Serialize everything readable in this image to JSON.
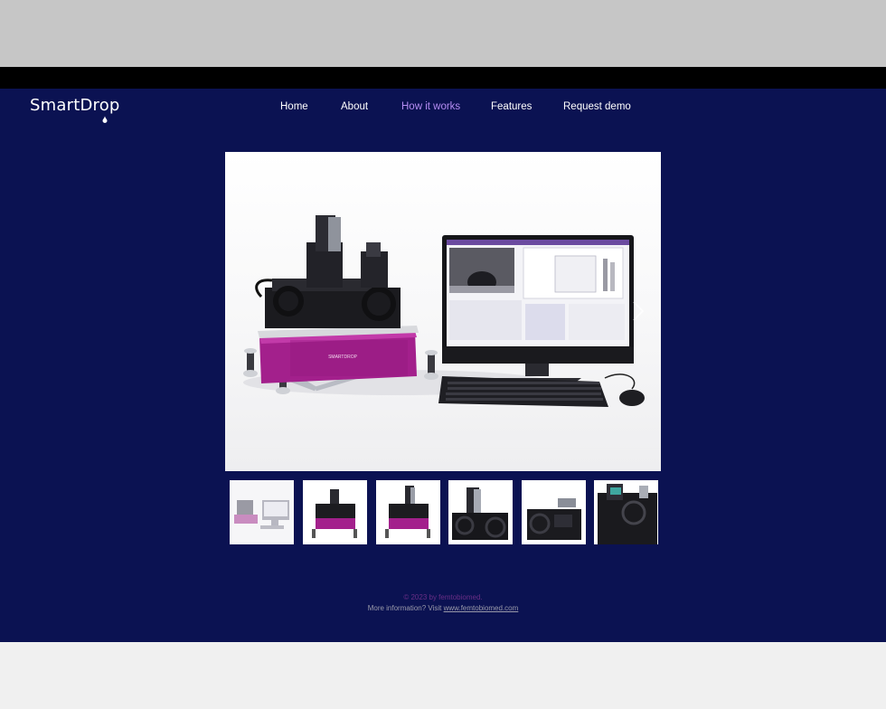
{
  "header": {
    "logo_text": "SmartDrop",
    "nav": [
      {
        "label": "Home",
        "active": false
      },
      {
        "label": "About",
        "active": false
      },
      {
        "label": "How it works",
        "active": true
      },
      {
        "label": "Features",
        "active": false
      },
      {
        "label": "Request demo",
        "active": false
      }
    ]
  },
  "hero": {
    "instrument_label": "SMARTDROP"
  },
  "gallery": {
    "thumbnail_count": 6
  },
  "footer": {
    "copyright": "© 2023 by femtobiomed.",
    "more_info_prefix": "More information? Visit ",
    "link_text": "www.femtobiomed.com"
  },
  "colors": {
    "page_background": "#0b1252",
    "active_nav": "#b48cf2",
    "instrument_magenta": "#a3208c",
    "copyright_text": "#6a2e86"
  }
}
